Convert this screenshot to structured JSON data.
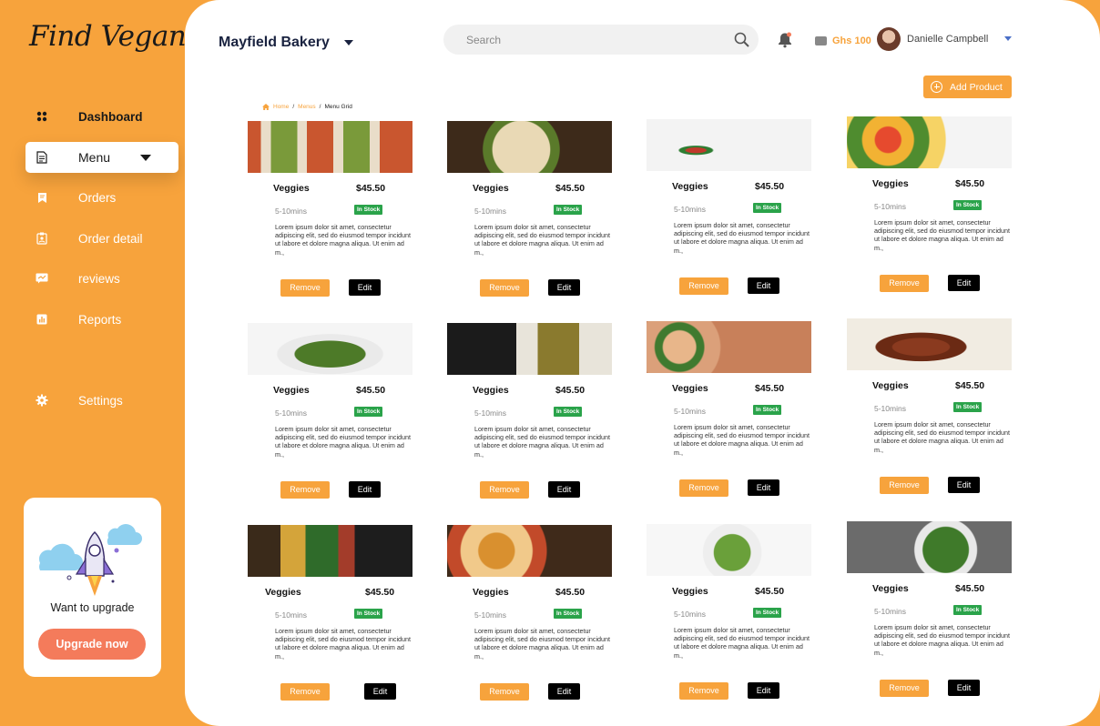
{
  "app": {
    "logo": "Find Vegan"
  },
  "sidebar": {
    "items": [
      {
        "label": "Dashboard",
        "icon": "grid-icon"
      },
      {
        "label": "Menu",
        "icon": "document-icon"
      },
      {
        "label": "Orders",
        "icon": "orders-icon"
      },
      {
        "label": "Order detail",
        "icon": "clipboard-icon"
      },
      {
        "label": "reviews",
        "icon": "review-icon"
      },
      {
        "label": "Reports",
        "icon": "chart-icon"
      },
      {
        "label": "Settings",
        "icon": "gear-icon"
      }
    ],
    "upgrade": {
      "title": "Want to upgrade",
      "button": "Upgrade now"
    }
  },
  "header": {
    "store": "Mayfield Bakery",
    "search_placeholder": "Search",
    "balance": "Ghs 100",
    "user": "Danielle Campbell",
    "add_product": "Add Product"
  },
  "breadcrumb": {
    "home": "Home",
    "menus": "Menus",
    "current": "Menu Grid"
  },
  "products": [
    {
      "name": "Veggies",
      "price": "$45.50",
      "time": "5-10mins",
      "stock": "In Stock",
      "desc": "Lorem ipsum dolor sit amet, consectetur adipiscing elit, sed do eiusmod tempor incidunt ut labore et dolore magna aliqua. Ut enim ad m.,",
      "remove": "Remove",
      "edit": "Edit"
    },
    {
      "name": "Veggies",
      "price": "$45.50",
      "time": "5-10mins",
      "stock": "In Stock",
      "desc": "Lorem ipsum dolor sit amet, consectetur adipiscing elit, sed do eiusmod tempor incidunt ut labore et dolore magna aliqua. Ut enim ad m.,",
      "remove": "Remove",
      "edit": "Edit"
    },
    {
      "name": "Veggies",
      "price": "$45.50",
      "time": "5-10mins",
      "stock": "In Stock",
      "desc": "Lorem ipsum dolor sit amet, consectetur adipiscing elit, sed do eiusmod tempor incidunt ut labore et dolore magna aliqua. Ut enim ad m.,",
      "remove": "Remove",
      "edit": "Edit"
    },
    {
      "name": "Veggies",
      "price": "$45.50",
      "time": "5-10mins",
      "stock": "In Stock",
      "desc": "Lorem ipsum dolor sit amet, consectetur adipiscing elit, sed do eiusmod tempor incidunt ut labore et dolore magna aliqua. Ut enim ad m.,",
      "remove": "Remove",
      "edit": "Edit"
    },
    {
      "name": "Veggies",
      "price": "$45.50",
      "time": "5-10mins",
      "stock": "In Stock",
      "desc": "Lorem ipsum dolor sit amet, consectetur adipiscing elit, sed do eiusmod tempor incidunt ut labore et dolore magna aliqua. Ut enim ad m.,",
      "remove": "Remove",
      "edit": "Edit"
    },
    {
      "name": "Veggies",
      "price": "$45.50",
      "time": "5-10mins",
      "stock": "In Stock",
      "desc": "Lorem ipsum dolor sit amet, consectetur adipiscing elit, sed do eiusmod tempor incidunt ut labore et dolore magna aliqua. Ut enim ad m.,",
      "remove": "Remove",
      "edit": "Edit"
    },
    {
      "name": "Veggies",
      "price": "$45.50",
      "time": "5-10mins",
      "stock": "In Stock",
      "desc": "Lorem ipsum dolor sit amet, consectetur adipiscing elit, sed do eiusmod tempor incidunt ut labore et dolore magna aliqua. Ut enim ad m.,",
      "remove": "Remove",
      "edit": "Edit"
    },
    {
      "name": "Veggies",
      "price": "$45.50",
      "time": "5-10mins",
      "stock": "In Stock",
      "desc": "Lorem ipsum dolor sit amet, consectetur adipiscing elit, sed do eiusmod tempor incidunt ut labore et dolore magna aliqua. Ut enim ad m.,",
      "remove": "Remove",
      "edit": "Edit"
    },
    {
      "name": "Veggies",
      "price": "$45.50",
      "time": "5-10mins",
      "stock": "In Stock",
      "desc": "Lorem ipsum dolor sit amet, consectetur adipiscing elit, sed do eiusmod tempor incidunt ut labore et dolore magna aliqua. Ut enim ad m.,",
      "remove": "Remove",
      "edit": "Edit"
    },
    {
      "name": "Veggies",
      "price": "$45.50",
      "time": "5-10mins",
      "stock": "In Stock",
      "desc": "Lorem ipsum dolor sit amet, consectetur adipiscing elit, sed do eiusmod tempor incidunt ut labore et dolore magna aliqua. Ut enim ad m.,",
      "remove": "Remove",
      "edit": "Edit"
    },
    {
      "name": "Veggies",
      "price": "$45.50",
      "time": "5-10mins",
      "stock": "In Stock",
      "desc": "Lorem ipsum dolor sit amet, consectetur adipiscing elit, sed do eiusmod tempor incidunt ut labore et dolore magna aliqua. Ut enim ad m.,",
      "remove": "Remove",
      "edit": "Edit"
    },
    {
      "name": "Veggies",
      "price": "$45.50",
      "time": "5-10mins",
      "stock": "In Stock",
      "desc": "Lorem ipsum dolor sit amet, consectetur adipiscing elit, sed do eiusmod tempor incidunt ut labore et dolore magna aliqua. Ut enim ad m.,",
      "remove": "Remove",
      "edit": "Edit"
    }
  ],
  "colors": {
    "accent": "#f7a33c",
    "stock": "#2aa34a",
    "upgrade": "#f47b5b"
  }
}
